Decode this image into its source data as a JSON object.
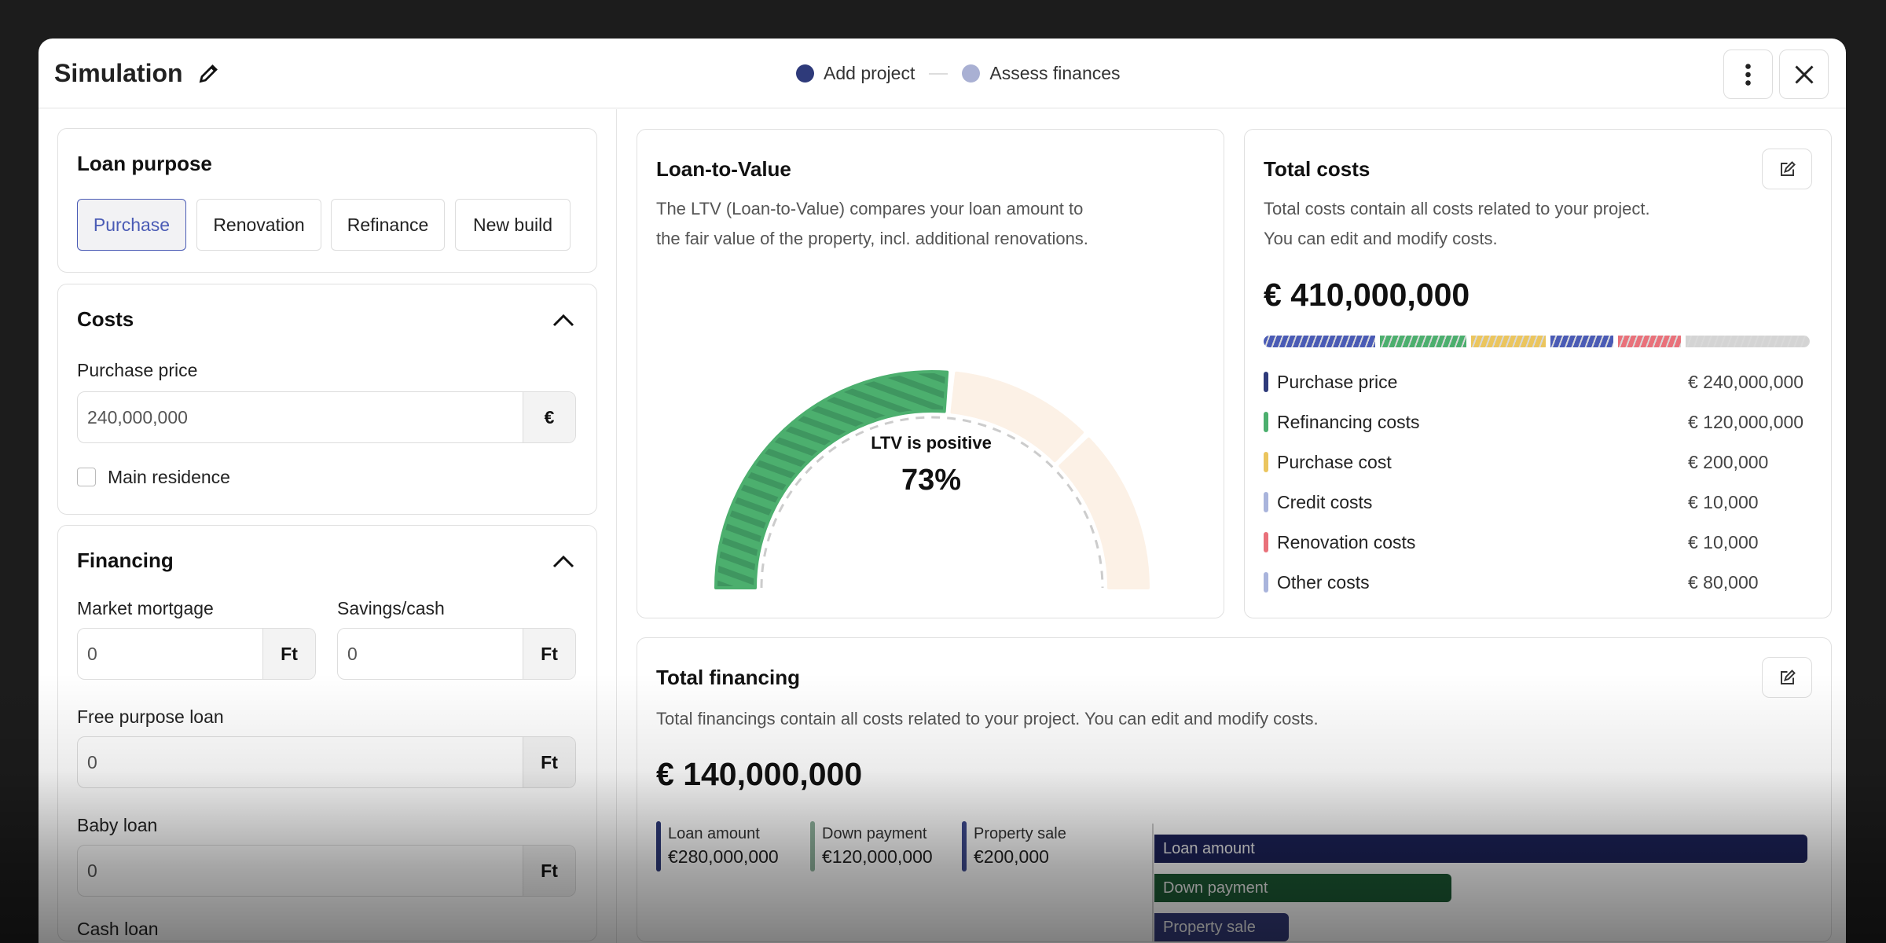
{
  "header": {
    "title": "Simulation",
    "steps": [
      {
        "label": "Add project",
        "color": "#2e3a7a"
      },
      {
        "label": "Assess finances",
        "color": "#a9b0d3"
      }
    ]
  },
  "loan_purpose": {
    "title": "Loan purpose",
    "options": [
      "Purchase",
      "Renovation",
      "Refinance",
      "New build"
    ],
    "selected": "Purchase"
  },
  "costs": {
    "title": "Costs",
    "purchase_price_label": "Purchase price",
    "purchase_price_value": "240,000,000",
    "currency": "€",
    "main_residence_label": "Main residence",
    "main_residence_checked": false
  },
  "financing": {
    "title": "Financing",
    "fields": [
      {
        "label": "Market mortgage",
        "value": "0",
        "unit": "Ft"
      },
      {
        "label": "Savings/cash",
        "value": "0",
        "unit": "Ft"
      },
      {
        "label": "Free purpose loan",
        "value": "0",
        "unit": "Ft"
      },
      {
        "label": "Baby loan",
        "value": "0",
        "unit": "Ft"
      },
      {
        "label": "Cash loan"
      }
    ]
  },
  "ltv": {
    "title": "Loan-to-Value",
    "desc1": "The LTV (Loan-to-Value) compares your loan amount to",
    "desc2": "the fair value of the property, incl. additional renovations.",
    "status": "LTV is positive",
    "value": "73%",
    "colors": {
      "filled": "#4caf6e",
      "stripe": "#3f9660",
      "empty": "#fcf1e6",
      "dash": "#cccccc"
    }
  },
  "total_costs": {
    "title": "Total costs",
    "desc1": "Total costs contain all costs related to your project.",
    "desc2": "You can edit and modify costs.",
    "total": "€ 410,000,000",
    "items": [
      {
        "label": "Purchase price",
        "amount": "€ 240,000,000",
        "color": "#2e3a7a"
      },
      {
        "label": "Refinancing costs",
        "amount": "€ 120,000,000",
        "color": "#4caf6e"
      },
      {
        "label": "Purchase cost",
        "amount": "€ 200,000",
        "color": "#ebc55e"
      },
      {
        "label": "Credit costs",
        "amount": "€ 10,000",
        "color": "#a9b4dc"
      },
      {
        "label": "Renovation costs",
        "amount": "€ 10,000",
        "color": "#e9717a"
      },
      {
        "label": "Other costs",
        "amount": "€ 80,000",
        "color": "#a9b4dc"
      }
    ],
    "bar_colors": [
      "#4a5bb5",
      "#4caf6e",
      "#ebc55e",
      "#4a5bb5",
      "#e9717a",
      "#d4d4d4"
    ]
  },
  "total_financing": {
    "title": "Total financing",
    "desc": "Total financings contain all costs related to your project. You can edit and modify costs.",
    "total": "€ 140,000,000",
    "items": [
      {
        "label": "Loan amount",
        "amount": "€280,000,000",
        "color": "#1c2259",
        "legend_color": "#2e3a7a"
      },
      {
        "label": "Down payment",
        "amount": "€120,000,000",
        "color": "#1c5a34",
        "legend_color": "#8fb39d"
      },
      {
        "label": "Property sale",
        "amount": "€200,000",
        "color": "#333a78",
        "legend_color": "#3e4a8f"
      }
    ]
  }
}
